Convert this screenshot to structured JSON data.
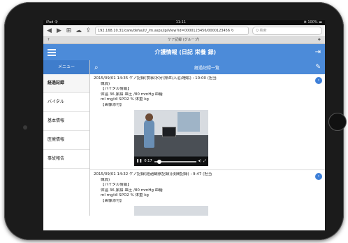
{
  "status_bar": {
    "left": "iPad 令",
    "time": "11:11",
    "right": "❋ 100% ▬"
  },
  "browser": {
    "back": "◀",
    "forward": "▶",
    "bookmarks": "⊞",
    "cloud": "☁",
    "share": "⇪",
    "url": "192.168.10.31/care/default/_/m.aspx/jp/View?id=0000123456/0000123456 ↻",
    "search_placeholder": "Q 検索"
  },
  "tab_strip": {
    "left": "?",
    "title": "ケア記録 (グループ)",
    "right": "✚"
  },
  "app_header": {
    "title": "介護情報 (日記 栄養 録)",
    "logout_icon": "logout-icon"
  },
  "sidebar": {
    "header": "メニュー",
    "items": [
      {
        "label": "経過記録",
        "active": true
      },
      {
        "label": "バイタル",
        "active": false
      },
      {
        "label": "基本情報",
        "active": false
      },
      {
        "label": "医療情報",
        "active": false
      },
      {
        "label": "事故報告",
        "active": false
      }
    ]
  },
  "main": {
    "title": "経過記録一覧"
  },
  "entries": [
    {
      "line1": "2015/09/01 14:35 ケア記録(食事/水分/排泄/入浴/睡眠) : 10:00 (担当",
      "line2": "職員)",
      "vital_header": "【バイタル情報】",
      "vital_line1": "体温 36 脈拍 血圧 /80 mmHg 血糖",
      "vital_line2": "ml mg/dl SPO2 % 体重 kg",
      "media_header": "【画像添付】",
      "video_time": "0:17",
      "video_progress": 0.08
    },
    {
      "line1": "2015/09/01 14:32 ケア記録(経過観察記録)(夜間記録) : 9:47 (担当",
      "line2": "職員)",
      "vital_header": "【バイタル情報】",
      "vital_line1": "体温 36 脈拍 血圧 /80 mmHg 血糖",
      "vital_line2": "ml mg/dl SPO2 % 体重 kg",
      "media_header": "【画像添付】"
    }
  ]
}
